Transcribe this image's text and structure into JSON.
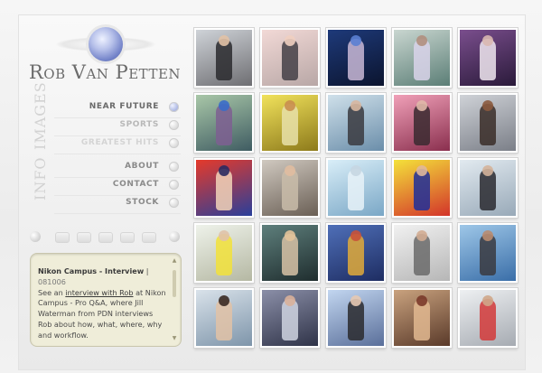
{
  "logo": {
    "title": "Rob Van Petten"
  },
  "sections": {
    "images": "IMAGES",
    "info": "INFO"
  },
  "nav": [
    {
      "label": "NEAR FUTURE",
      "state": "active"
    },
    {
      "label": "SPORTS",
      "state": "normal"
    },
    {
      "label": "GREATEST HITS",
      "state": "faint"
    },
    {
      "label": "ABOUT",
      "state": "normal"
    },
    {
      "label": "CONTACT",
      "state": "normal"
    },
    {
      "label": "STOCK",
      "state": "normal"
    }
  ],
  "news": {
    "title": "Nikon Campus - Interview",
    "separator": "|",
    "date": "081006",
    "text_before": "See an ",
    "link": "interview with Rob",
    "text_after": " at Nikon Campus - Pro Q&A, where Jill Waterman from PDN interviews Rob about how, what, where, why and workflow."
  },
  "thumbnails": [
    {
      "bg": [
        "#cfd3d8",
        "#6e6e72"
      ],
      "fig": "#2a2a2e",
      "head": "#e2c2a6"
    },
    {
      "bg": [
        "#f2d9d6",
        "#b8a7a6"
      ],
      "fig": "#444046",
      "head": "#f0cfc0"
    },
    {
      "bg": [
        "#1e3a7a",
        "#0b142e"
      ],
      "fig": "#c9b8d6",
      "head": "#5a7fd3"
    },
    {
      "bg": [
        "#c9d6d0",
        "#5b7e76"
      ],
      "fig": "#d9d3ea",
      "head": "#b08f7e"
    },
    {
      "bg": [
        "#7a4e8d",
        "#2a1a3a"
      ],
      "fig": "#eee6ef",
      "head": "#d9b8b0"
    },
    {
      "bg": [
        "#a9c7a8",
        "#3f5c62"
      ],
      "fig": "#7e5f92",
      "head": "#3a6dc9"
    },
    {
      "bg": [
        "#f1e25b",
        "#8d7a1b"
      ],
      "fig": "#e8e0a9",
      "head": "#c98e4e"
    },
    {
      "bg": [
        "#cfe0ea",
        "#6b8eaa"
      ],
      "fig": "#3a3a40",
      "head": "#d8b7a0"
    },
    {
      "bg": [
        "#f0a0b8",
        "#8a2f4e"
      ],
      "fig": "#3a2a30",
      "head": "#e0b8a8"
    },
    {
      "bg": [
        "#cfd2d7",
        "#7b7f88"
      ],
      "fig": "#3a2d28",
      "head": "#8b5a3e"
    },
    {
      "bg": [
        "#e63a2a",
        "#2a3f9a"
      ],
      "fig": "#f2d3b8",
      "head": "#2a2a60"
    },
    {
      "bg": [
        "#d0c9c0",
        "#6a5f55"
      ],
      "fig": "#c9bca9",
      "head": "#e0bca0"
    },
    {
      "bg": [
        "#d9eef8",
        "#7aa7c6"
      ],
      "fig": "#e8f2f8",
      "head": "#c6d6e2"
    },
    {
      "bg": [
        "#f4e23a",
        "#d3342a"
      ],
      "fig": "#1f2f9a",
      "head": "#e0b89a"
    },
    {
      "bg": [
        "#e2eaf0",
        "#98a9b8"
      ],
      "fig": "#2a2a30",
      "head": "#d4b39a"
    },
    {
      "bg": [
        "#eef2ea",
        "#b5b8a3"
      ],
      "fig": "#f2e23a",
      "head": "#e0c2a8"
    },
    {
      "bg": [
        "#5e7f7c",
        "#1f2d2e"
      ],
      "fig": "#d7c2a6",
      "head": "#e2c39a"
    },
    {
      "bg": [
        "#4f6fb8",
        "#1e2d62"
      ],
      "fig": "#e1aa3a",
      "head": "#c9523a"
    },
    {
      "bg": [
        "#f1f1f1",
        "#b6b6b6"
      ],
      "fig": "#6a6a6a",
      "head": "#d2ac92"
    },
    {
      "bg": [
        "#9ec7e8",
        "#3a6ea8"
      ],
      "fig": "#3a3a40",
      "head": "#b98c70"
    },
    {
      "bg": [
        "#d9e2ea",
        "#7e95aa"
      ],
      "fig": "#e2c2a6",
      "head": "#3a2a24"
    },
    {
      "bg": [
        "#8b8fa8",
        "#2f3348"
      ],
      "fig": "#cfd3e0",
      "head": "#d9b09a"
    },
    {
      "bg": [
        "#c2d6f0",
        "#5a6f9a"
      ],
      "fig": "#2a2a2e",
      "head": "#e6c9b3"
    },
    {
      "bg": [
        "#c9a27e",
        "#5a3a2a"
      ],
      "fig": "#e2b890",
      "head": "#7a3a2a"
    },
    {
      "bg": [
        "#eef0f2",
        "#a6abb2"
      ],
      "fig": "#d23a3a",
      "head": "#cfa78a"
    }
  ]
}
